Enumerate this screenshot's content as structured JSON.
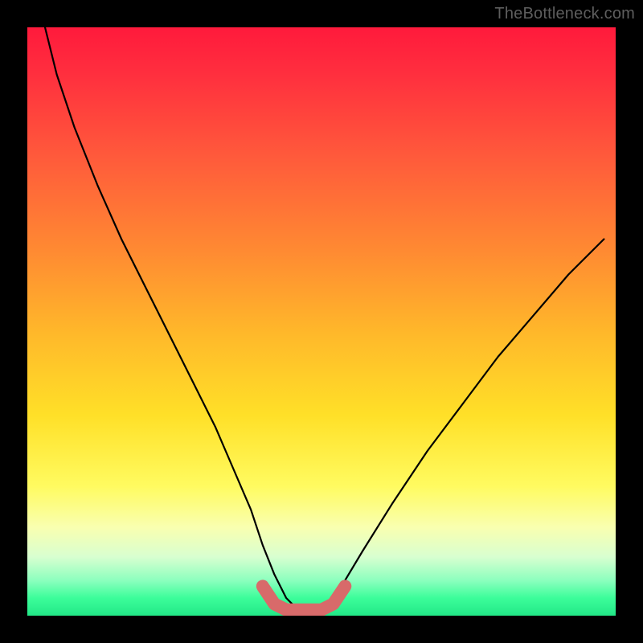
{
  "watermark": "TheBottleneck.com",
  "chart_data": {
    "type": "line",
    "title": "",
    "xlabel": "",
    "ylabel": "",
    "xlim": [
      0,
      100
    ],
    "ylim": [
      0,
      100
    ],
    "grid": false,
    "legend": false,
    "background_gradient": {
      "top_color": "#ff1a3c",
      "mid_color": "#ffe028",
      "bottom_color": "#22e887",
      "meaning": "bottleneck severity (red high, green low)"
    },
    "series": [
      {
        "name": "bottleneck_curve",
        "color": "#000000",
        "x": [
          3,
          5,
          8,
          12,
          16,
          20,
          24,
          28,
          32,
          35,
          38,
          40,
          42,
          44,
          46,
          50,
          52,
          54,
          57,
          62,
          68,
          74,
          80,
          86,
          92,
          98
        ],
        "y": [
          100,
          92,
          83,
          73,
          64,
          56,
          48,
          40,
          32,
          25,
          18,
          12,
          7,
          3,
          1,
          1,
          3,
          6,
          11,
          19,
          28,
          36,
          44,
          51,
          58,
          64
        ]
      },
      {
        "name": "optimal_range_highlight",
        "color": "#d86a6a",
        "x": [
          40,
          42,
          44,
          46,
          48,
          50,
          52,
          54
        ],
        "y": [
          5,
          2,
          1,
          1,
          1,
          1,
          2,
          5
        ]
      }
    ]
  }
}
